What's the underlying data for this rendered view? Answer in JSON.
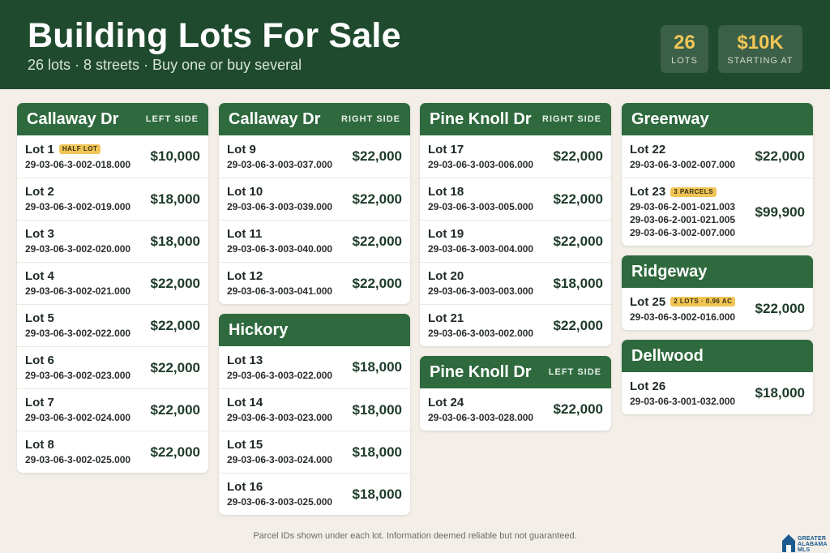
{
  "header": {
    "title": "Building Lots For Sale",
    "subtitle": "26 lots · 8 streets · Buy one or buy several",
    "stats": [
      {
        "value": "26",
        "label": "LOTS"
      },
      {
        "value": "$10K",
        "label": "STARTING AT"
      }
    ]
  },
  "columns": [
    {
      "cards": [
        {
          "street": "Callaway Dr",
          "side": "LEFT SIDE",
          "lots": [
            {
              "name": "Lot 1",
              "badge": "HALF LOT",
              "parcels": [
                "29-03-06-3-002-018.000"
              ],
              "price": "$10,000"
            },
            {
              "name": "Lot 2",
              "parcels": [
                "29-03-06-3-002-019.000"
              ],
              "price": "$18,000"
            },
            {
              "name": "Lot 3",
              "parcels": [
                "29-03-06-3-002-020.000"
              ],
              "price": "$18,000"
            },
            {
              "name": "Lot 4",
              "parcels": [
                "29-03-06-3-002-021.000"
              ],
              "price": "$22,000"
            },
            {
              "name": "Lot 5",
              "parcels": [
                "29-03-06-3-002-022.000"
              ],
              "price": "$22,000"
            },
            {
              "name": "Lot 6",
              "parcels": [
                "29-03-06-3-002-023.000"
              ],
              "price": "$22,000"
            },
            {
              "name": "Lot 7",
              "parcels": [
                "29-03-06-3-002-024.000"
              ],
              "price": "$22,000"
            },
            {
              "name": "Lot 8",
              "parcels": [
                "29-03-06-3-002-025.000"
              ],
              "price": "$22,000"
            }
          ]
        }
      ]
    },
    {
      "cards": [
        {
          "street": "Callaway Dr",
          "side": "RIGHT SIDE",
          "lots": [
            {
              "name": "Lot 9",
              "parcels": [
                "29-03-06-3-003-037.000"
              ],
              "price": "$22,000"
            },
            {
              "name": "Lot 10",
              "parcels": [
                "29-03-06-3-003-039.000"
              ],
              "price": "$22,000"
            },
            {
              "name": "Lot 11",
              "parcels": [
                "29-03-06-3-003-040.000"
              ],
              "price": "$22,000"
            },
            {
              "name": "Lot 12",
              "parcels": [
                "29-03-06-3-003-041.000"
              ],
              "price": "$22,000"
            }
          ]
        },
        {
          "street": "Hickory",
          "side": "",
          "lots": [
            {
              "name": "Lot 13",
              "parcels": [
                "29-03-06-3-003-022.000"
              ],
              "price": "$18,000"
            },
            {
              "name": "Lot 14",
              "parcels": [
                "29-03-06-3-003-023.000"
              ],
              "price": "$18,000"
            },
            {
              "name": "Lot 15",
              "parcels": [
                "29-03-06-3-003-024.000"
              ],
              "price": "$18,000"
            },
            {
              "name": "Lot 16",
              "parcels": [
                "29-03-06-3-003-025.000"
              ],
              "price": "$18,000"
            }
          ]
        }
      ]
    },
    {
      "cards": [
        {
          "street": "Pine Knoll Dr",
          "side": "RIGHT SIDE",
          "lots": [
            {
              "name": "Lot 17",
              "parcels": [
                "29-03-06-3-003-006.000"
              ],
              "price": "$22,000"
            },
            {
              "name": "Lot 18",
              "parcels": [
                "29-03-06-3-003-005.000"
              ],
              "price": "$22,000"
            },
            {
              "name": "Lot 19",
              "parcels": [
                "29-03-06-3-003-004.000"
              ],
              "price": "$22,000"
            },
            {
              "name": "Lot 20",
              "parcels": [
                "29-03-06-3-003-003.000"
              ],
              "price": "$18,000"
            },
            {
              "name": "Lot 21",
              "parcels": [
                "29-03-06-3-003-002.000"
              ],
              "price": "$22,000"
            }
          ]
        },
        {
          "street": "Pine Knoll Dr",
          "side": "LEFT SIDE",
          "lots": [
            {
              "name": "Lot 24",
              "parcels": [
                "29-03-06-3-003-028.000"
              ],
              "price": "$22,000"
            }
          ]
        }
      ]
    },
    {
      "cards": [
        {
          "street": "Greenway",
          "side": "",
          "lots": [
            {
              "name": "Lot 22",
              "parcels": [
                "29-03-06-3-002-007.000"
              ],
              "price": "$22,000"
            },
            {
              "name": "Lot 23",
              "badge": "3 PARCELS",
              "parcels": [
                "29-03-06-2-001-021.003",
                "29-03-06-2-001-021.005",
                "29-03-06-3-002-007.000"
              ],
              "price": "$99,900"
            }
          ]
        },
        {
          "street": "Ridgeway",
          "side": "",
          "lots": [
            {
              "name": "Lot 25",
              "badge": "2 LOTS · 0.96 AC",
              "parcels": [
                "29-03-06-3-002-016.000"
              ],
              "price": "$22,000"
            }
          ]
        },
        {
          "street": "Dellwood",
          "side": "",
          "lots": [
            {
              "name": "Lot 26",
              "parcels": [
                "29-03-06-3-001-032.000"
              ],
              "price": "$18,000"
            }
          ]
        }
      ]
    }
  ],
  "footer": {
    "note": "Parcel IDs shown under each lot. Information deemed reliable but not guaranteed.",
    "logo_text": [
      "GREATER",
      "ALABAMA",
      "MLS"
    ]
  },
  "colors": {
    "header_bg": "#1f4a2e",
    "card_head_bg": "#2f6a3e",
    "accent_gold": "#f0c556",
    "page_bg": "#f3efe8"
  }
}
